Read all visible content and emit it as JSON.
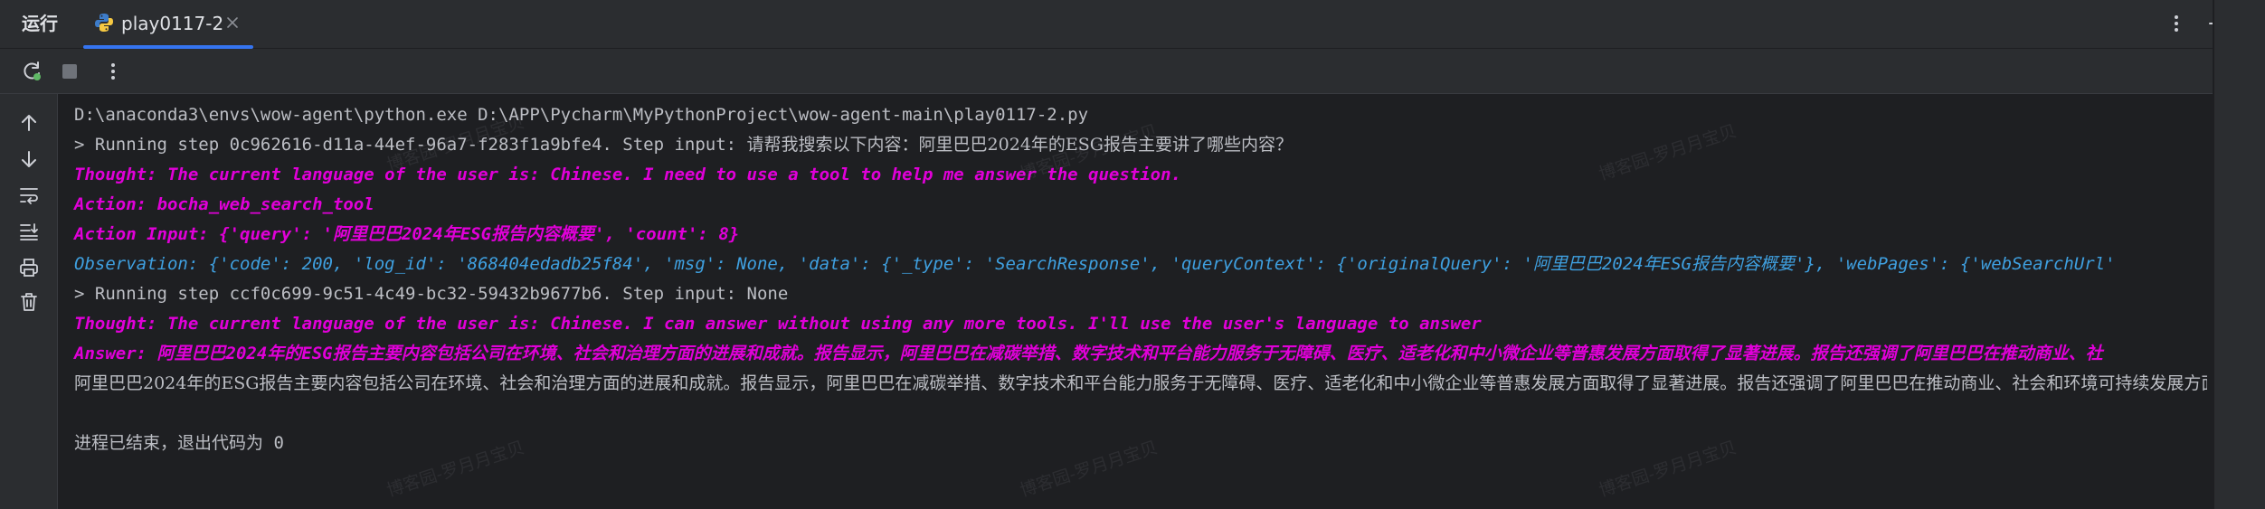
{
  "header": {
    "run_label": "运行",
    "tab_label": "play0117-2"
  },
  "icons": {
    "python": "python-file-icon",
    "close": "close-icon",
    "more": "vertical-dots-icon",
    "minimize": "minimize-icon",
    "rerun": "rerun-icon",
    "stop": "stop-icon",
    "scroll_up": "arrow-up-icon",
    "scroll_down": "arrow-down-icon",
    "soft_wrap": "soft-wrap-icon",
    "scroll_end": "scroll-to-end-icon",
    "print": "print-icon",
    "clear": "trash-icon"
  },
  "colors": {
    "accent": "#3574f0",
    "thought": "#e000d8",
    "observation": "#3fa0e0",
    "plain": "#bcbec4"
  },
  "watermark": "博客园-罗月月宝贝",
  "console": {
    "lines": [
      "D:\\anaconda3\\envs\\wow-agent\\python.exe D:\\APP\\Pycharm\\MyPythonProject\\wow-agent-main\\play0117-2.py",
      "> Running step 0c962616-d11a-44ef-96a7-f283f1a9bfe4. Step input: ",
      "请帮我搜索以下内容：阿里巴巴2024年的ESG报告主要讲了哪些内容？",
      "Thought: The current language of the user is: Chinese. I need to use a tool to help me answer the question.",
      "Action: bocha_web_search_tool",
      "Action Input: {'query': '阿里巴巴2024年ESG报告内容概要', 'count': 8}",
      "Observation: {'code': 200, 'log_id': '868404edadb25f84', 'msg': None, 'data': {'_type': 'SearchResponse', 'queryContext': {'originalQuery': '阿里巴巴2024年ESG报告内容概要'}, 'webPages': {'webSearchUrl'",
      "> Running step ccf0c699-9c51-4c49-bc32-59432b9677b6. Step input: None",
      "Thought: The current language of the user is: Chinese. I can answer without using any more tools. I'll use the user's language to answer",
      "Answer: 阿里巴巴2024年的ESG报告主要内容包括公司在环境、社会和治理方面的进展和成就。报告显示，阿里巴巴在减碳举措、数字技术和平台能力服务于无障碍、医疗、适老化和中小微企业等普惠发展方面取得了显著进展。报告还强调了阿里巴巴在推动商业、社",
      "阿里巴巴2024年的ESG报告主要内容包括公司在环境、社会和治理方面的进展和成就。报告显示，阿里巴巴在减碳举措、数字技术和平台能力服务于无障碍、医疗、适老化和中小微企业等普惠发展方面取得了显著进展。报告还强调了阿里巴巴在推动商业、社会和环境可持续发展方面",
      "",
      "进程已结束，退出代码为 0"
    ]
  }
}
